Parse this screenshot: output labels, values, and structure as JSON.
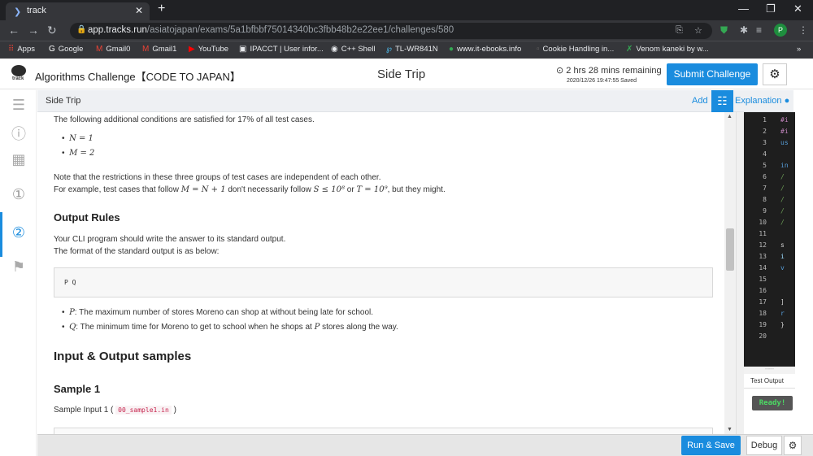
{
  "browser": {
    "tab_title": "track",
    "new_tab": "+",
    "url_host": "app.tracks.run",
    "url_path": "/asiatojapan/exams/5a1bfbbf75014340bc3fbb48b2e22ee1/challenges/580",
    "profile_initial": "P",
    "bookmarks": [
      {
        "icon": "apps-icon",
        "label": "Apps"
      },
      {
        "icon": "google-icon",
        "label": "Google"
      },
      {
        "icon": "gmail-icon",
        "label": "Gmail0"
      },
      {
        "icon": "gmail-icon",
        "label": "Gmail1"
      },
      {
        "icon": "youtube-icon",
        "label": "YouTube"
      },
      {
        "icon": "ipacct-icon",
        "label": "IPACCT | User infor..."
      },
      {
        "icon": "cpp-icon",
        "label": "C++ Shell"
      },
      {
        "icon": "tplink-icon",
        "label": "TL-WR841N"
      },
      {
        "icon": "globe-icon",
        "label": "www.it-ebooks.info"
      },
      {
        "icon": "page-icon",
        "label": "Cookie Handling in..."
      },
      {
        "icon": "star-icon",
        "label": "Venom kaneki by w..."
      }
    ],
    "bookmarks_overflow": "»"
  },
  "header": {
    "logo_text": "track",
    "app_title": "Algorithms Challenge【CODE TO JAPAN】",
    "challenge_name": "Side Trip",
    "timer": "2 hrs 28 mins remaining",
    "saved": "2020/12/26 19:47:55 Saved",
    "submit_label": "Submit Challenge"
  },
  "subheader": {
    "title": "Side Trip",
    "add_label": "Add",
    "explanation_label": "Explanation"
  },
  "problem": {
    "conditions_intro": "The following additional conditions are satisfied for 17% of all test cases.",
    "cond1": "N = 1",
    "cond2": "M = 2",
    "note1": "Note that the restrictions in these three groups of test cases are independent of each other.",
    "note2_a": "For example, test cases that follow",
    "note2_m": "M = N + 1",
    "note2_b": "don't necessarily follow",
    "note2_s": "S ≤ 10⁸",
    "note2_or": "or",
    "note2_t": "T = 10⁹",
    "note2_c": ", but they might.",
    "output_rules_title": "Output Rules",
    "output_rules_1": "Your CLI program should write the answer to its standard output.",
    "output_rules_2": "The format of the standard output is as below:",
    "format": "P Q",
    "p_var": "P",
    "p_desc": ": The maximum number of stores Moreno can shop at without being late for school.",
    "q_var": "Q",
    "q_desc_a": ": The minimum time for Moreno to get to school when he shops at",
    "q_desc_p": "P",
    "q_desc_b": "stores along the way.",
    "samples_title": "Input & Output samples",
    "sample1_title": "Sample 1",
    "sample1_input_a": "Sample Input 1 (",
    "sample1_file": "00_sample1.in",
    "sample1_input_b": ")"
  },
  "editor": {
    "line_numbers": [
      "1",
      "2",
      "3",
      "4",
      "5",
      "6",
      "7",
      "8",
      "9",
      "10",
      "11",
      "12",
      "13",
      "14",
      "15",
      "16",
      "17",
      "18",
      "19",
      "20"
    ],
    "lines": [
      {
        "n": 1,
        "text": "#i",
        "color": "#c586c0"
      },
      {
        "n": 2,
        "text": "#i",
        "color": "#c586c0"
      },
      {
        "n": 3,
        "text": "us",
        "color": "#569cd6"
      },
      {
        "n": 5,
        "text": "in",
        "color": "#569cd6"
      },
      {
        "n": 6,
        "text": "/",
        "color": "#6a9955"
      },
      {
        "n": 7,
        "text": "/",
        "color": "#6a9955"
      },
      {
        "n": 8,
        "text": "/",
        "color": "#6a9955"
      },
      {
        "n": 9,
        "text": "/",
        "color": "#6a9955"
      },
      {
        "n": 10,
        "text": "/",
        "color": "#6a9955"
      },
      {
        "n": 12,
        "text": "s",
        "color": "#d4d4d4"
      },
      {
        "n": 13,
        "text": "i",
        "color": "#9cdcfe"
      },
      {
        "n": 14,
        "text": "v",
        "color": "#569cd6"
      },
      {
        "n": 17,
        "text": "]",
        "color": "#d4d4d4"
      },
      {
        "n": 18,
        "text": "r",
        "color": "#569cd6"
      },
      {
        "n": 19,
        "text": "}",
        "color": "#d4d4d4"
      }
    ],
    "output_tab": "Test Output",
    "ready": "Ready!"
  },
  "footer": {
    "run_label": "Run & Save",
    "debug_label": "Debug"
  },
  "colors": {
    "accent": "#1a8cde",
    "editor_bg": "#1e1e1e",
    "ready_green": "#4cd964"
  }
}
